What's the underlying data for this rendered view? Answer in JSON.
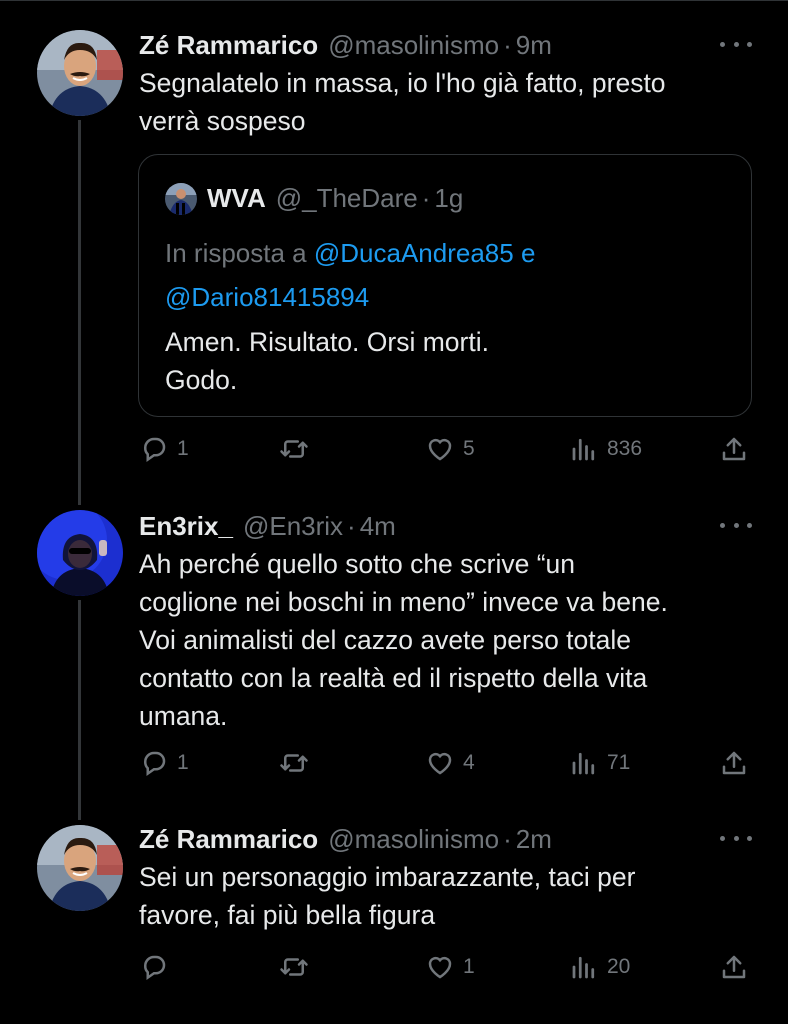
{
  "thread": [
    {
      "author_name": "Zé Rammarico",
      "handle": "@masolinismo",
      "time": "9m",
      "text_lines": [
        "Segnalatelo in massa, io l'ho già fatto, presto",
        "verrà sospeso"
      ],
      "quote": {
        "author_name": "WVA",
        "handle": "@_TheDare",
        "time": "1g",
        "reply_prefix": "In risposta a",
        "mention1": "@DucaAndrea85",
        "reply_joiner": "e",
        "mention2": "@Dario81415894",
        "text_lines": [
          "Amen. Risultato. Orsi morti.",
          "Godo."
        ]
      },
      "stats": {
        "replies": "1",
        "retweets": "",
        "likes": "5",
        "views": "836"
      }
    },
    {
      "author_name": "En3rix_",
      "handle": "@En3rix",
      "time": "4m",
      "text_lines": [
        "Ah perché quello sotto che scrive “un",
        "coglione nei boschi in meno” invece va bene.",
        "Voi animalisti del cazzo avete perso totale",
        "contatto con la realtà ed il rispetto della vita",
        "umana."
      ],
      "stats": {
        "replies": "1",
        "retweets": "",
        "likes": "4",
        "views": "71"
      }
    },
    {
      "author_name": "Zé Rammarico",
      "handle": "@masolinismo",
      "time": "2m",
      "text_lines": [
        "Sei un personaggio imbarazzante, taci per",
        "favore, fai più bella figura"
      ],
      "stats": {
        "replies": "",
        "retweets": "",
        "likes": "1",
        "views": "20"
      }
    }
  ],
  "separator": "·",
  "icons": [
    "reply-icon",
    "retweet-icon",
    "like-icon",
    "views-icon",
    "share-icon",
    "more-icon"
  ],
  "colors": {
    "background": "#000000",
    "text": "#e7e9ea",
    "muted": "#71767b",
    "link": "#1d9bf0",
    "border": "#2f3336"
  }
}
